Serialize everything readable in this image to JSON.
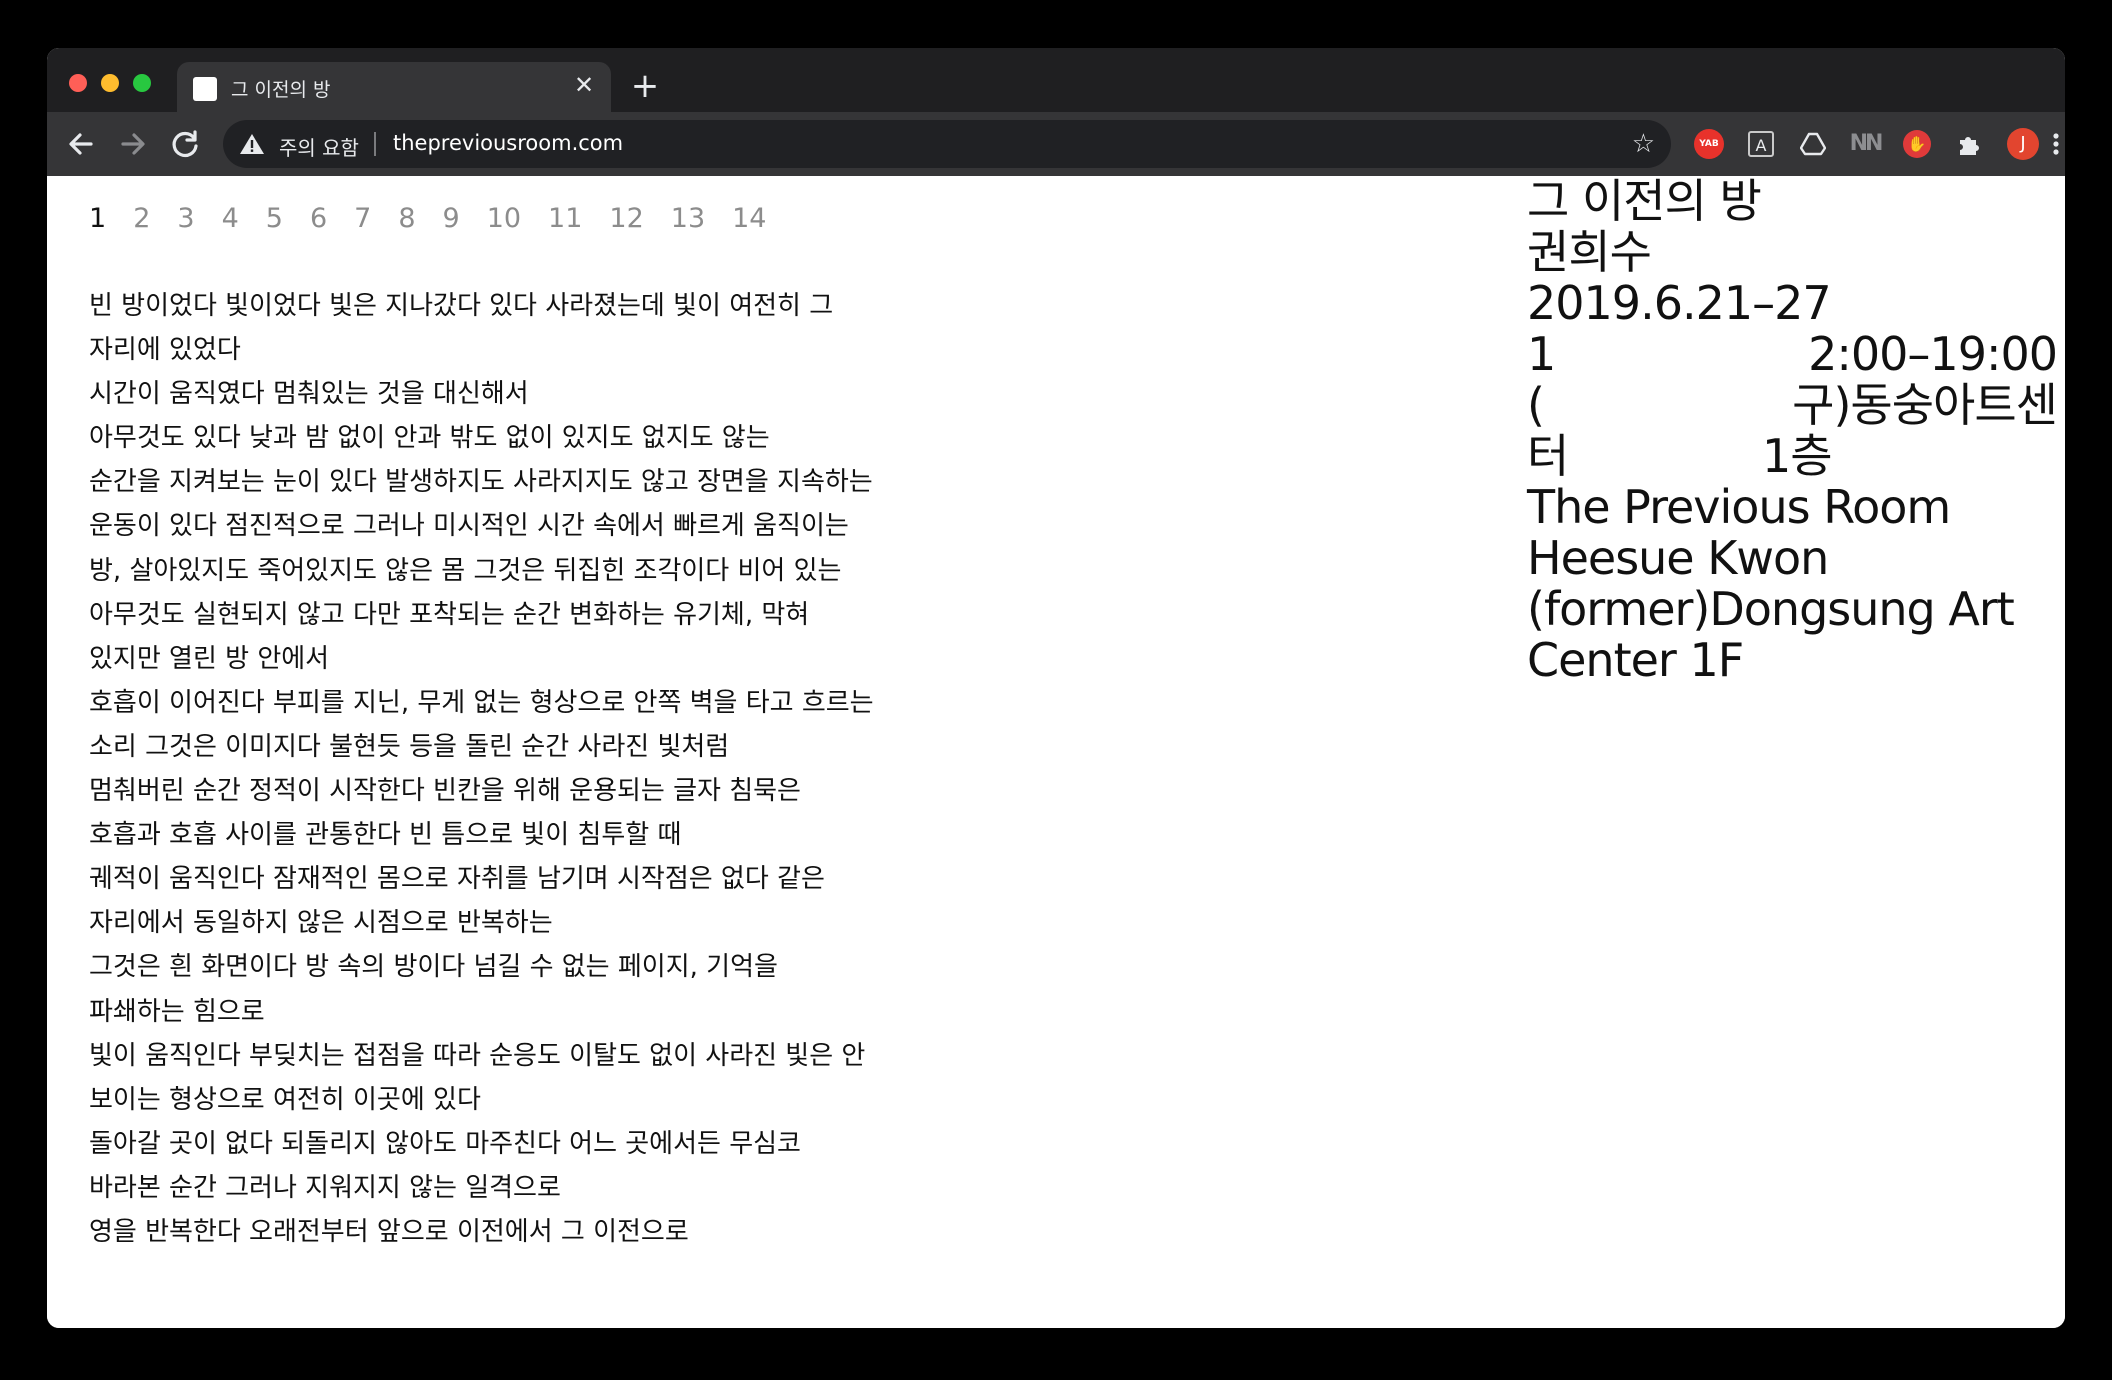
{
  "browser": {
    "tab_title": "그 이전의 방",
    "tab_close_glyph": "✕",
    "new_tab_glyph": "+",
    "security_label": "주의 요함",
    "url": "thepreviousroom.com",
    "nav_icons": [
      "back-icon",
      "forward-icon",
      "reload-icon"
    ],
    "extensions": [
      {
        "name": "yab-extension",
        "label": "YAB",
        "color": "#e8322b"
      },
      {
        "name": "a-extension",
        "label": "A"
      },
      {
        "name": "drive-extension",
        "label": "△"
      },
      {
        "name": "nn-extension",
        "label": "NN"
      },
      {
        "name": "red-extension",
        "label": "✋",
        "color": "#e03a3a"
      },
      {
        "name": "puzzle-extension",
        "label": "✱"
      }
    ],
    "avatar_initial": "J",
    "avatar_color": "#e2452f"
  },
  "pager": [
    "1",
    "2",
    "3",
    "4",
    "5",
    "6",
    "7",
    "8",
    "9",
    "10",
    "11",
    "12",
    "13",
    "14"
  ],
  "pager_active_index": 0,
  "poem_lines": [
    "빈 방이었다 빛이었다 빛은 지나갔다 있다 사라졌는데 빛이 여전히 그",
    "자리에 있었다",
    "시간이 움직였다 멈춰있는 것을 대신해서",
    "아무것도 있다 낮과 밤 없이 안과 밖도 없이 있지도 없지도 않는",
    "순간을 지켜보는 눈이 있다 발생하지도 사라지지도 않고 장면을 지속하는",
    "운동이 있다 점진적으로 그러나 미시적인 시간 속에서 빠르게 움직이는",
    "방, 살아있지도 죽어있지도 않은 몸 그것은 뒤집힌 조각이다 비어 있는",
    "아무것도 실현되지 않고 다만 포착되는 순간 변화하는 유기체, 막혀",
    "있지만 열린 방 안에서",
    "호흡이 이어진다 부피를 지닌, 무게 없는 형상으로 안쪽 벽을 타고 흐르는",
    "소리 그것은 이미지다 불현듯 등을 돌린 순간 사라진 빛처럼",
    "멈춰버린 순간 정적이 시작한다 빈칸을 위해 운용되는 글자 침묵은",
    "호흡과 호흡 사이를 관통한다 빈 틈으로 빛이 침투할 때",
    "궤적이 움직인다 잠재적인 몸으로 자취를 남기며 시작점은 없다 같은",
    "자리에서 동일하지 않은 시점으로 반복하는",
    "그것은 흰 화면이다 방 속의 방이다 넘길 수 없는 페이지, 기억을",
    "파쇄하는 힘으로",
    "빛이 움직인다 부딪치는 접점을 따라 순응도 이탈도 없이 사라진 빛은 안",
    "보이는 형상으로 여전히 이곳에 있다",
    "돌아갈 곳이 없다 되돌리지 않아도 마주친다 어느 곳에서든 무심코",
    "바라본 순간 그러나 지워지지 않는 일격으로",
    "영을 반복한다 오래전부터 앞으로 이전에서 그 이전으로"
  ],
  "info": {
    "title_ko": "그 이전의 방",
    "artist_ko": "권희수",
    "dates": "2019.6.21–27",
    "hours_left": "1",
    "hours_right": "2:00–19:00",
    "venue_ko_left": "(",
    "venue_ko_right": "구)동숭아트센",
    "venue_ko_cont_left": "터",
    "venue_ko_cont_right": "1층",
    "title_en": "The Previous Room",
    "artist_en": "Heesue Kwon",
    "venue_en": "(former)Dongsung Art",
    "venue_en_cont": "Center 1F"
  }
}
